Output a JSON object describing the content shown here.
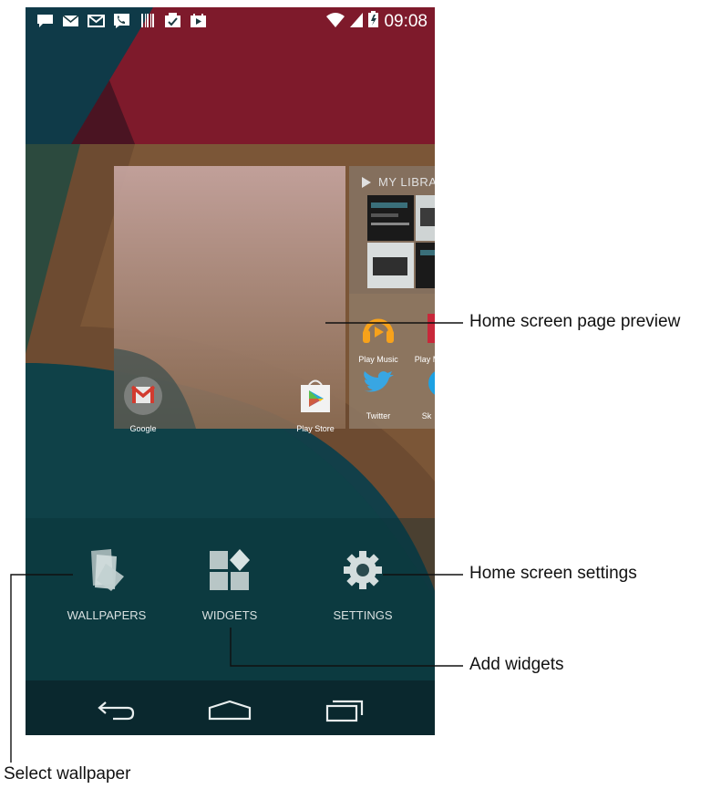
{
  "status_bar": {
    "left_icons": [
      "chat-icon",
      "mail-icon",
      "gmail-icon",
      "voicemail-icon",
      "barcode-icon",
      "task-icon",
      "play-store-icon"
    ],
    "right_icons": [
      "wifi-icon",
      "signal-icon",
      "battery-icon"
    ],
    "time": "09:08"
  },
  "page_preview": {
    "widget_title": "MY LIBRA",
    "apps_page1": [
      {
        "label": "Google",
        "icon": "gmail-folder-icon"
      },
      {
        "label": "Play Store",
        "icon": "play-store-icon"
      }
    ],
    "apps_page2": [
      {
        "label": "Play Music",
        "icon": "headphones-icon"
      },
      {
        "label": "Play Mo",
        "icon": "play-movies-icon"
      },
      {
        "label": "Twitter",
        "icon": "twitter-bird-icon"
      },
      {
        "label": "Sk",
        "icon": "skype-icon"
      }
    ]
  },
  "options": [
    {
      "label": "WALLPAPERS",
      "icon": "wallpaper-stack-icon"
    },
    {
      "label": "WIDGETS",
      "icon": "widgets-grid-icon"
    },
    {
      "label": "SETTINGS",
      "icon": "gear-icon"
    }
  ],
  "navigation": [
    "back-icon",
    "home-icon",
    "recent-apps-icon"
  ],
  "callouts": {
    "page_preview": "Home screen page preview",
    "settings": "Home screen settings",
    "widgets": "Add widgets",
    "wallpaper": "Select wallpaper"
  },
  "colors": {
    "wall_teal": "#0e3c46",
    "wall_maroon": "#5a1425",
    "wall_red": "#8a1a2a",
    "wall_brown": "#7a5a38",
    "preview_pink": "#c6a3a0"
  }
}
